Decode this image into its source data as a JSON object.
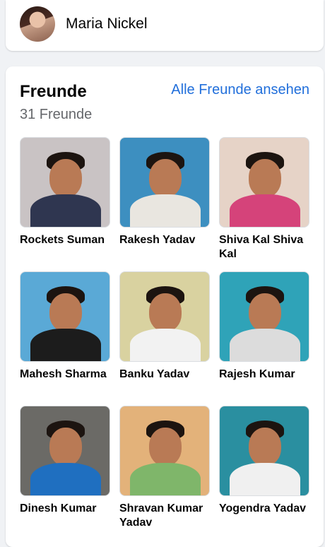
{
  "profile_bar": {
    "name": "Maria Nickel"
  },
  "friends": {
    "title": "Freunde",
    "see_all_label": "Alle Freunde ansehen",
    "count_text": "31 Freunde",
    "items": [
      {
        "name": "Rockets Suman",
        "bg": "#c9c3c4",
        "shirt": "#2f3650"
      },
      {
        "name": "Rakesh Yadav",
        "bg": "#3d8fc0",
        "shirt": "#e9e6e0"
      },
      {
        "name": "Shiva Kal Shiva Kal",
        "bg": "#e6d3c7",
        "shirt": "#d5437a"
      },
      {
        "name": "Mahesh Sharma",
        "bg": "#5aa9d6",
        "shirt": "#1c1c1c"
      },
      {
        "name": "Banku Yadav",
        "bg": "#d9d2a0",
        "shirt": "#f2f2f2"
      },
      {
        "name": "Rajesh Kumar",
        "bg": "#2fa3b8",
        "shirt": "#dcdcdc"
      },
      {
        "name": "Dinesh Kumar",
        "bg": "#6b6a66",
        "shirt": "#1f6fc0"
      },
      {
        "name": "Shravan Kumar Yadav",
        "bg": "#e3b27a",
        "shirt": "#7fb66a"
      },
      {
        "name": "Yogendra Yadav",
        "bg": "#2a8fa0",
        "shirt": "#f0f0f0"
      }
    ]
  }
}
